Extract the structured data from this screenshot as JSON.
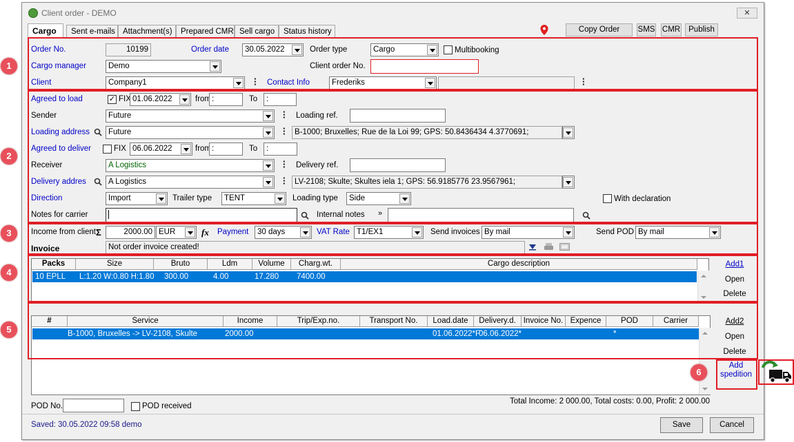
{
  "window": {
    "title": "Client order - DEMO",
    "close": "✕"
  },
  "tabs": [
    "Cargo",
    "Sent e-mails",
    "Attachment(s)",
    "Prepared CMR",
    "Sell cargo",
    "Status history"
  ],
  "toolbar": {
    "copy_order": "Copy Order",
    "sms": "SMS",
    "cmr": "CMR",
    "publish": "Publish"
  },
  "callouts": [
    "1",
    "2",
    "3",
    "4",
    "5",
    "6"
  ],
  "order": {
    "order_no_label": "Order No.",
    "order_no": "10199",
    "order_date_label": "Order date",
    "order_date": "30.05.2022",
    "order_type_label": "Order type",
    "order_type": "Cargo",
    "multibooking_label": "Multibooking",
    "cargo_manager_label": "Cargo manager",
    "cargo_manager": "Demo",
    "client_order_no_label": "Client order No.",
    "client_order_no": "",
    "client_label": "Client",
    "client": "Company1",
    "contact_info_label": "Contact Info",
    "contact_info": "Frederiks",
    "contact_extra": ""
  },
  "route": {
    "agreed_load_label": "Agreed to load",
    "fix_label": "FIX",
    "load_date": "01.06.2022",
    "from_label": "from",
    "to_label": "To",
    "time_placeholder": ":",
    "sender_label": "Sender",
    "sender": "Future",
    "loading_ref_label": "Loading ref.",
    "loading_ref": "",
    "loading_address_label": "Loading address",
    "loading_address": "Future",
    "loading_address_full": "B-1000; Bruxelles; Rue de la Loi 99; GPS: 50.8436434 4.3770691;",
    "agreed_deliver_label": "Agreed to deliver",
    "deliver_date": "06.06.2022",
    "receiver_label": "Receiver",
    "receiver": "A Logistics",
    "delivery_ref_label": "Delivery ref.",
    "delivery_ref": "",
    "delivery_address_label": "Delivery addres",
    "delivery_address": "A Logistics",
    "delivery_address_full": "LV-2108; Skulte; Skultes iela 1; GPS: 56.9185776 23.9567961;",
    "direction_label": "Direction",
    "direction": "Import",
    "trailer_type_label": "Trailer type",
    "trailer_type": "TENT",
    "loading_type_label": "Loading type",
    "loading_type": "Side",
    "with_declaration_label": "With declaration",
    "notes_carrier_label": "Notes for carrier",
    "notes_carrier": "",
    "internal_notes_label": "Internal notes",
    "internal_notes": ""
  },
  "finance": {
    "income_label": "Income from client",
    "sigma": "Σ",
    "income": "2000.00",
    "currency": "EUR",
    "fx": "fx",
    "payment_label": "Payment",
    "payment": "30 days",
    "vat_rate_label": "VAT Rate",
    "vat_rate": "T1/EX1",
    "send_invoices_label": "Send invoices",
    "send_invoices": "By mail",
    "send_pod_label": "Send POD",
    "send_pod": "By mail",
    "invoice_label": "Invoice",
    "invoice_status": "Not order invoice created!"
  },
  "cargo_table": {
    "headers": [
      "Packs",
      "Size",
      "Bruto",
      "Ldm",
      "Volume",
      "Charg.wt.",
      "Cargo description"
    ],
    "rows": [
      [
        "10 EPLL",
        "L:1.20 W:0.80 H:1.80",
        "300.00",
        "4.00",
        "17.280",
        "7400.00",
        ""
      ]
    ],
    "add": "Add1",
    "open": "Open",
    "delete": "Delete"
  },
  "service_table": {
    "headers": [
      "#",
      "Service",
      "Income",
      "Trip/Exp.no.",
      "Transport No.",
      "Load.date",
      "Delivery.d.",
      "Invoice No.",
      "Expence",
      "POD",
      "Carrier"
    ],
    "rows": [
      [
        "",
        "B-1000, Bruxelles -> LV-2108, Skulte",
        "2000.00",
        "",
        "",
        "01.06.2022*F",
        "06.06.2022*",
        "",
        "",
        "*",
        ""
      ]
    ],
    "add": "Add2",
    "open": "Open",
    "delete": "Delete",
    "add_spedition": "Add spedition"
  },
  "footer": {
    "pod_no_label": "POD No.",
    "pod_no": "",
    "pod_received_label": "POD received",
    "totals": "Total Income: 2 000.00, Total costs: 0.00, Profit: 2 000.00",
    "saved": "Saved: 30.05.2022 09:58 demo",
    "save": "Save",
    "cancel": "Cancel"
  },
  "colors": {
    "callout_red": "#e01e26",
    "selection": "#0078d7",
    "label_blue": "#0000c8"
  }
}
